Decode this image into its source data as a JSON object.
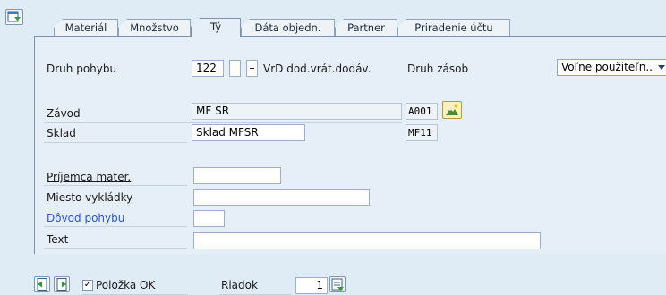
{
  "tabs": [
    {
      "label": "Materiál"
    },
    {
      "label": "Množstvo"
    },
    {
      "label": "Tý"
    },
    {
      "label": "Dáta objedn."
    },
    {
      "label": "Partner"
    },
    {
      "label": "Priradenie účtu"
    }
  ],
  "active_tab": "Tý",
  "movement": {
    "label": "Druh pohybu",
    "type_value": "122",
    "indicator1": "",
    "indicator2": "–",
    "description": "VrD dod.vrát.dodáv.",
    "stock_type_label": "Druh zásob",
    "stock_type_value": "Voľne použiteľn.."
  },
  "plant": {
    "label": "Závod",
    "value": "MF SR",
    "code": "A001"
  },
  "storage": {
    "label": "Sklad",
    "value": "Sklad MFSR",
    "code": "MF11"
  },
  "recipient": {
    "label": "Príjemca mater.",
    "value": ""
  },
  "unloading": {
    "label": "Miesto vykládky",
    "value": ""
  },
  "reason": {
    "label": "Dôvod pohybu",
    "value": ""
  },
  "text": {
    "label": "Text",
    "value": ""
  },
  "footer": {
    "item_ok_label": "Položka OK",
    "item_ok_checked": "✓",
    "row_label": "Riadok",
    "row_value": "1"
  }
}
